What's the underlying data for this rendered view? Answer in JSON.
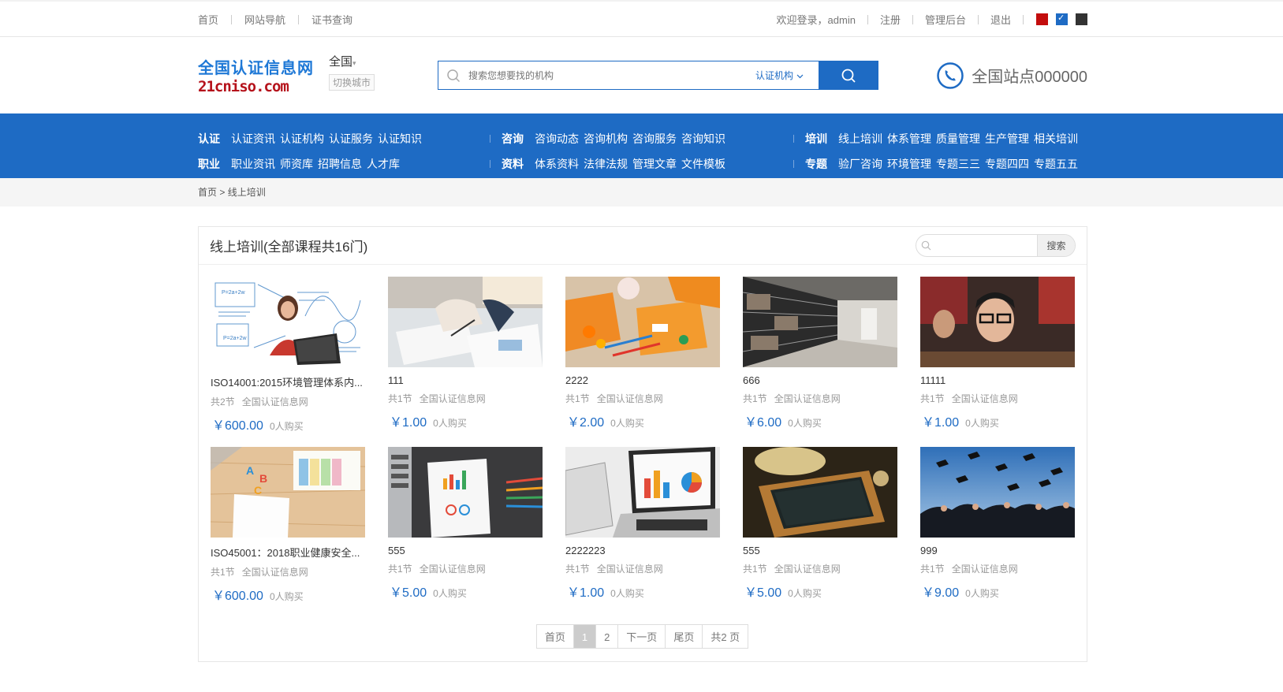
{
  "topbar": {
    "links": [
      "首页",
      "网站导航",
      "证书查询"
    ],
    "welcome": "欢迎登录，admin",
    "register": "注册",
    "admin": "管理后台",
    "logout": "退出",
    "theme_colors": [
      "#c30d0d",
      "#1e6bc4",
      "#333333"
    ]
  },
  "header": {
    "logo_cn": "全国认证信息网",
    "logo_en": "21cniso.com",
    "city": "全国",
    "city_switch": "切换城市",
    "search_placeholder": "搜索您想要找的机构",
    "search_type": "认证机构",
    "hotline": "全国站点000000"
  },
  "nav": {
    "row1": [
      {
        "cat": "认证",
        "items": [
          "认证资讯",
          "认证机构",
          "认证服务",
          "认证知识"
        ]
      },
      {
        "cat": "咨询",
        "items": [
          "咨询动态",
          "咨询机构",
          "咨询服务",
          "咨询知识"
        ]
      },
      {
        "cat": "培训",
        "items": [
          "线上培训",
          "体系管理",
          "质量管理",
          "生产管理",
          "相关培训"
        ]
      }
    ],
    "row2": [
      {
        "cat": "职业",
        "items": [
          "职业资讯",
          "师资库",
          "招聘信息",
          "人才库"
        ]
      },
      {
        "cat": "资料",
        "items": [
          "体系资料",
          "法律法规",
          "管理文章",
          "文件模板"
        ]
      },
      {
        "cat": "专题",
        "items": [
          "验厂咨询",
          "环境管理",
          "专题三三",
          "专题四四",
          "专题五五"
        ]
      }
    ]
  },
  "breadcrumb": {
    "home": "首页",
    "sep": ">",
    "current": "线上培训"
  },
  "panel": {
    "title": "线上培训(全部课程共16门)",
    "search_btn": "搜索"
  },
  "courses": [
    {
      "title": "ISO14001:2015环境管理体系内...",
      "sections": "共2节",
      "org": "全国认证信息网",
      "price": "￥600.00",
      "buyers": "0人购买"
    },
    {
      "title": "111",
      "sections": "共1节",
      "org": "全国认证信息网",
      "price": "￥1.00",
      "buyers": "0人购买"
    },
    {
      "title": "2222",
      "sections": "共1节",
      "org": "全国认证信息网",
      "price": "￥2.00",
      "buyers": "0人购买"
    },
    {
      "title": "666",
      "sections": "共1节",
      "org": "全国认证信息网",
      "price": "￥6.00",
      "buyers": "0人购买"
    },
    {
      "title": "11111",
      "sections": "共1节",
      "org": "全国认证信息网",
      "price": "￥1.00",
      "buyers": "0人购买"
    },
    {
      "title": "ISO45001：2018职业健康安全...",
      "sections": "共1节",
      "org": "全国认证信息网",
      "price": "￥600.00",
      "buyers": "0人购买"
    },
    {
      "title": "555",
      "sections": "共1节",
      "org": "全国认证信息网",
      "price": "￥5.00",
      "buyers": "0人购买"
    },
    {
      "title": "2222223",
      "sections": "共1节",
      "org": "全国认证信息网",
      "price": "￥1.00",
      "buyers": "0人购买"
    },
    {
      "title": "555",
      "sections": "共1节",
      "org": "全国认证信息网",
      "price": "￥5.00",
      "buyers": "0人购买"
    },
    {
      "title": "999",
      "sections": "共1节",
      "org": "全国认证信息网",
      "price": "￥9.00",
      "buyers": "0人购买"
    }
  ],
  "pager": {
    "first": "首页",
    "pages": [
      "1",
      "2"
    ],
    "next": "下一页",
    "last": "尾页",
    "total": "共2 页"
  }
}
